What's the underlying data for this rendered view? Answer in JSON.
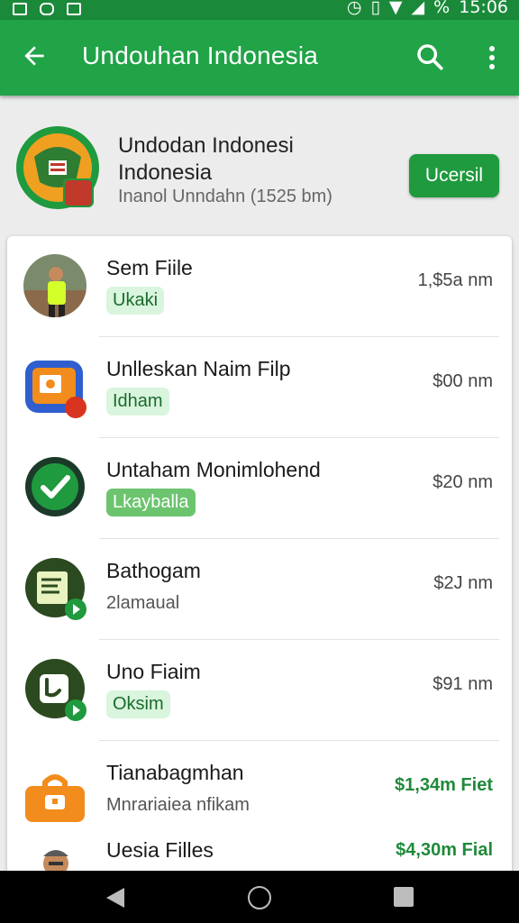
{
  "statusbar": {
    "time": "15:06",
    "battery_glyph": "%"
  },
  "appbar": {
    "title": "Undouhan Indonesia"
  },
  "header": {
    "title": "Undodan Indonesi Indonesia",
    "subtitle": "Inanol Unndahn (1525 bm)",
    "button_label": "Ucersil"
  },
  "items": [
    {
      "name": "Sem Fiile",
      "tag": "Ukaki",
      "price": "1,$5a nm"
    },
    {
      "name": "Unlleskan Naim Filp",
      "tag": "Idham",
      "price": "$00 nm"
    },
    {
      "name": "Untaham Monimlohend",
      "tag": "Lkayballa",
      "price": "$20 nm"
    },
    {
      "name": "Bathogam",
      "tag": "2lamaual",
      "price": "$2J nm"
    },
    {
      "name": "Uno Fiaim",
      "tag": "Oksim",
      "price": "$91 nm"
    },
    {
      "name": "Tianabagmhan",
      "tag": "Mnrariaiea nfikam",
      "price": "$1,34m Fiet"
    },
    {
      "name": "Uesia Filles",
      "tag": "",
      "price": "$4,30m Fial"
    }
  ],
  "icons": {
    "back": "arrow-back-icon",
    "search": "search-icon",
    "more": "more-vert-icon"
  },
  "colors": {
    "primary": "#21a347",
    "accent_dark": "#1f9a3e",
    "tag_bg": "#d9f5dd"
  }
}
